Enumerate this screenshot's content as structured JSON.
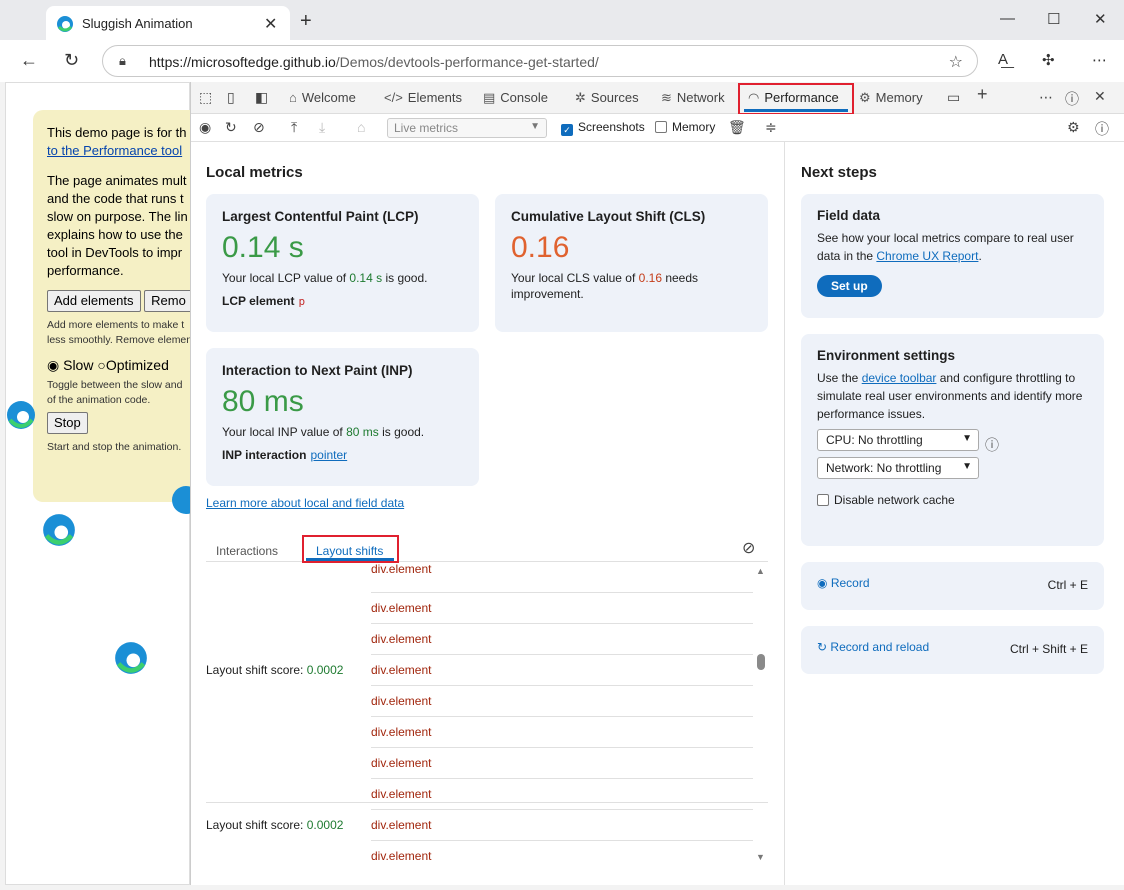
{
  "browser": {
    "tab_title": "Sluggish Animation",
    "url_host": "https://microsoftedge.github.io",
    "url_path": "/Demos/devtools-performance-get-started/"
  },
  "demo": {
    "intro_line1": "This demo page is for th",
    "intro_link": "to the Performance tool",
    "para2": [
      "The page animates mult",
      "and the code that runs t",
      "slow on purpose. The lin",
      "explains how to use the",
      "tool in DevTools to impr",
      "performance."
    ],
    "add_button": "Add elements",
    "remove_button": "Remo",
    "add_note": [
      "Add more elements to make t",
      "less smoothly. Remove elemen"
    ],
    "radio_slow": "Slow",
    "radio_optimized": "Optimized",
    "toggle_note": [
      "Toggle between the slow and",
      "of the animation code."
    ],
    "stop_button": "Stop",
    "stop_note": "Start and stop the animation."
  },
  "devtools": {
    "tabs": [
      "Welcome",
      "Elements",
      "Console",
      "Sources",
      "Network",
      "Performance",
      "Memory"
    ],
    "toolbar": {
      "live_metrics": "Live metrics",
      "screenshots": "Screenshots",
      "memory": "Memory"
    },
    "local_metrics": {
      "title": "Local metrics",
      "lcp": {
        "title": "Largest Contentful Paint (LCP)",
        "value": "0.14 s",
        "desc_pre": "Your local LCP value of ",
        "desc_val": "0.14 s",
        "desc_post": " is good.",
        "sub_label": "LCP element",
        "sub_value": "p"
      },
      "cls": {
        "title": "Cumulative Layout Shift (CLS)",
        "value": "0.16",
        "desc_pre": "Your local CLS value of ",
        "desc_val": "0.16",
        "desc_post": " needs improvement."
      },
      "inp": {
        "title": "Interaction to Next Paint (INP)",
        "value": "80 ms",
        "desc_pre": "Your local INP value of ",
        "desc_val": "80 ms",
        "desc_post": " is good.",
        "sub_label": "INP interaction",
        "sub_value": "pointer"
      },
      "learn_more": "Learn more about local and field data"
    },
    "subtabs": {
      "interactions": "Interactions",
      "layout_shifts": "Layout shifts"
    },
    "layout_shifts": {
      "score_label": "Layout shift score:",
      "scores": [
        "0.0002",
        "0.0002"
      ],
      "element": "div.element"
    },
    "next_steps": {
      "title": "Next steps",
      "field_data": {
        "title": "Field data",
        "text_pre": "See how your local metrics compare to real user data in the ",
        "link": "Chrome UX Report",
        "text_post": ".",
        "button": "Set up"
      },
      "env": {
        "title": "Environment settings",
        "text_pre": "Use the ",
        "link": "device toolbar",
        "text_post": " and configure throttling to simulate real user environments and identify more performance issues.",
        "cpu": "CPU: No throttling",
        "network": "Network: No throttling",
        "disable_cache": "Disable network cache"
      },
      "record": {
        "label": "Record",
        "shortcut": "Ctrl + E"
      },
      "record_reload": {
        "label": "Record and reload",
        "shortcut": "Ctrl + Shift + E"
      }
    }
  },
  "colors": {
    "accent": "#0f6cbd",
    "good": "#3a9a47",
    "needs_improvement": "#e0622f",
    "highlight": "#e0202f"
  }
}
